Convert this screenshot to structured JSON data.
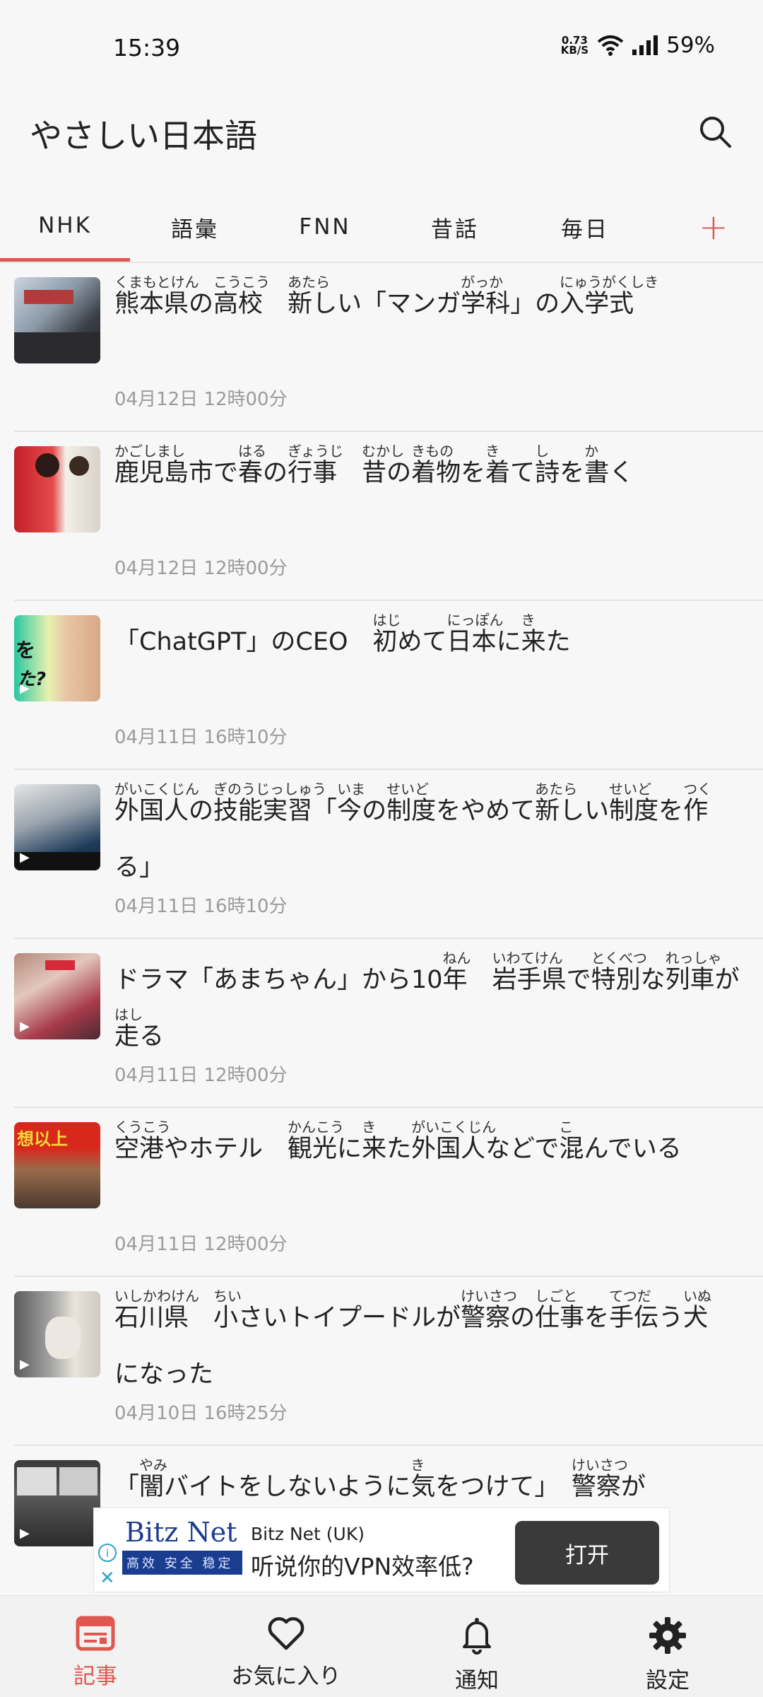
{
  "status_bar": {
    "time": "15:39",
    "net_speed_value": "0.73",
    "net_speed_unit": "KB/S",
    "battery": "59%"
  },
  "app_bar": {
    "title": "やさしい日本語",
    "search_icon": "search-icon"
  },
  "tabs": [
    {
      "label": "NHK",
      "active": true
    },
    {
      "label": "語彙",
      "active": false
    },
    {
      "label": "FNN",
      "active": false
    },
    {
      "label": "昔話",
      "active": false
    },
    {
      "label": "毎日",
      "active": false
    },
    {
      "label": "+",
      "active": false
    }
  ],
  "articles": [
    {
      "date": "04月12日 12時00分",
      "segments": [
        {
          "text": "熊本県",
          "ruby": "くまもとけん"
        },
        {
          "text": "の"
        },
        {
          "text": "高校",
          "ruby": "こうこう"
        },
        {
          "text": "　"
        },
        {
          "text": "新",
          "ruby": "あたら"
        },
        {
          "text": "しい「マンガ"
        },
        {
          "text": "学科",
          "ruby": "がっか"
        },
        {
          "text": "」の"
        },
        {
          "text": "入学式",
          "ruby": "にゅうがくしき"
        }
      ]
    },
    {
      "date": "04月12日 12時00分",
      "segments": [
        {
          "text": "鹿児島市",
          "ruby": "かごしまし"
        },
        {
          "text": "で"
        },
        {
          "text": "春",
          "ruby": "はる"
        },
        {
          "text": "の"
        },
        {
          "text": "行事",
          "ruby": "ぎょうじ"
        },
        {
          "text": "　"
        },
        {
          "text": "昔",
          "ruby": "むかし"
        },
        {
          "text": "の"
        },
        {
          "text": "着物",
          "ruby": "きもの"
        },
        {
          "text": "を"
        },
        {
          "text": "着",
          "ruby": "き"
        },
        {
          "text": "て"
        },
        {
          "text": "詩",
          "ruby": "し"
        },
        {
          "text": "を"
        },
        {
          "text": "書",
          "ruby": "か"
        },
        {
          "text": "く"
        }
      ]
    },
    {
      "date": "04月11日 16時10分",
      "segments": [
        {
          "text": "「ChatGPT」のCEO　"
        },
        {
          "text": "初",
          "ruby": "はじ"
        },
        {
          "text": "めて"
        },
        {
          "text": "日本",
          "ruby": "にっぽん"
        },
        {
          "text": "に"
        },
        {
          "text": "来",
          "ruby": "き"
        },
        {
          "text": "た"
        }
      ]
    },
    {
      "date": "04月11日 16時10分",
      "segments": [
        {
          "text": "外国人",
          "ruby": "がいこくじん"
        },
        {
          "text": "の"
        },
        {
          "text": "技能実習",
          "ruby": "ぎのうじっしゅう"
        },
        {
          "text": "「"
        },
        {
          "text": "今",
          "ruby": "いま"
        },
        {
          "text": "の"
        },
        {
          "text": "制度",
          "ruby": "せいど"
        },
        {
          "text": "をやめて"
        },
        {
          "text": "新",
          "ruby": "あたら"
        },
        {
          "text": "しい"
        },
        {
          "text": "制度",
          "ruby": "せいど"
        },
        {
          "text": "を"
        },
        {
          "text": "作",
          "ruby": "つく"
        },
        {
          "text": "る」"
        }
      ]
    },
    {
      "date": "04月11日 12時00分",
      "segments": [
        {
          "text": "ドラマ「あまちゃん」から10"
        },
        {
          "text": "年",
          "ruby": "ねん"
        },
        {
          "text": "　"
        },
        {
          "text": "岩手県",
          "ruby": "いわてけん"
        },
        {
          "text": "で"
        },
        {
          "text": "特別",
          "ruby": "とくべつ"
        },
        {
          "text": "な"
        },
        {
          "text": "列車",
          "ruby": "れっしゃ"
        },
        {
          "text": "が"
        },
        {
          "text": "走",
          "ruby": "はし"
        },
        {
          "text": "る"
        }
      ]
    },
    {
      "date": "04月11日 12時00分",
      "segments": [
        {
          "text": "空港",
          "ruby": "くうこう"
        },
        {
          "text": "やホテル　"
        },
        {
          "text": "観光",
          "ruby": "かんこう"
        },
        {
          "text": "に"
        },
        {
          "text": "来",
          "ruby": "き"
        },
        {
          "text": "た"
        },
        {
          "text": "外国人",
          "ruby": "がいこくじん"
        },
        {
          "text": "などで"
        },
        {
          "text": "混",
          "ruby": "こ"
        },
        {
          "text": "んでいる"
        }
      ]
    },
    {
      "date": "04月10日 16時25分",
      "segments": [
        {
          "text": "石川県",
          "ruby": "いしかわけん"
        },
        {
          "text": "　"
        },
        {
          "text": "小",
          "ruby": "ちい"
        },
        {
          "text": "さいトイプードルが"
        },
        {
          "text": "警察",
          "ruby": "けいさつ"
        },
        {
          "text": "の"
        },
        {
          "text": "仕事",
          "ruby": "しごと"
        },
        {
          "text": "を"
        },
        {
          "text": "手伝",
          "ruby": "てつだ"
        },
        {
          "text": "う"
        },
        {
          "text": "犬",
          "ruby": "いぬ"
        },
        {
          "text": "になった"
        }
      ]
    },
    {
      "date": "",
      "segments": [
        {
          "text": "「"
        },
        {
          "text": "闇",
          "ruby": "やみ"
        },
        {
          "text": "バイトをしないように"
        },
        {
          "text": "気",
          "ruby": "き"
        },
        {
          "text": "をつけて」　"
        },
        {
          "text": "警察",
          "ruby": "けいさつ"
        },
        {
          "text": "が"
        }
      ]
    }
  ],
  "ad": {
    "brand": "Bitz Net",
    "tagline": "高效 安全 稳定",
    "source": "Bitz Net (UK)",
    "text": "听说你的VPN效率低?",
    "button": "打开",
    "info_icon": "info-icon",
    "close_icon": "close-icon"
  },
  "bottom_nav": [
    {
      "label": "記事",
      "icon": "newspaper-icon",
      "active": true
    },
    {
      "label": "お気に入り",
      "icon": "heart-icon",
      "active": false
    },
    {
      "label": "通知",
      "icon": "bell-icon",
      "active": false
    },
    {
      "label": "設定",
      "icon": "gear-icon",
      "active": false
    }
  ],
  "colors": {
    "accent": "#e0574f",
    "background": "#f7f7f7",
    "date_text": "#9b9b9b",
    "ad_brand": "#1a3d8f"
  }
}
